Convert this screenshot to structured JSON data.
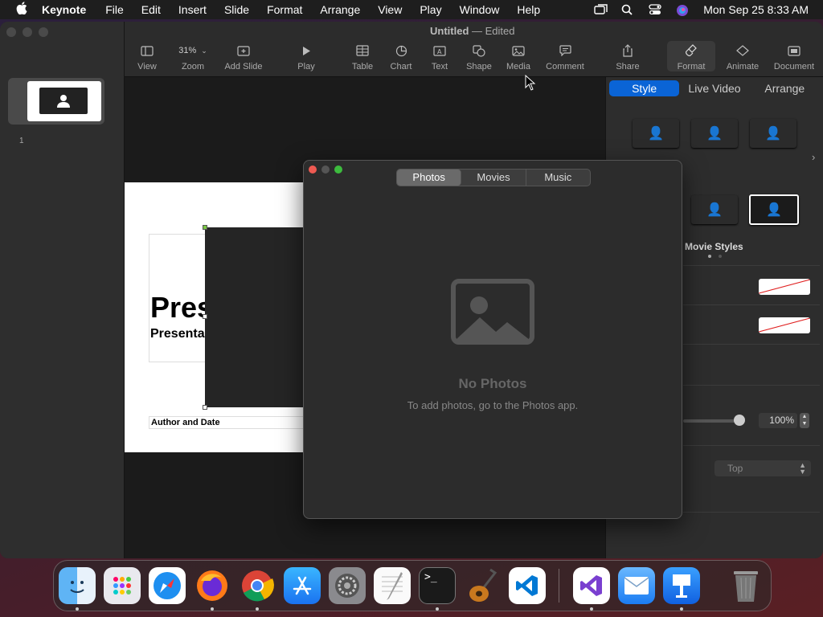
{
  "menubar": {
    "app_name": "Keynote",
    "items": [
      "File",
      "Edit",
      "Insert",
      "Slide",
      "Format",
      "Arrange",
      "View",
      "Play",
      "Window",
      "Help"
    ],
    "datetime": "Mon Sep 25  8:33 AM"
  },
  "window": {
    "doc_name": "Untitled",
    "doc_state": "Edited"
  },
  "toolbar": {
    "zoom_value": "31%",
    "items": [
      {
        "label": "View",
        "icon": "sidebar-icon"
      },
      {
        "label": "Zoom",
        "icon": "zoom-icon"
      },
      {
        "label": "Add Slide",
        "icon": "add-slide-icon"
      },
      {
        "label": "Play",
        "icon": "play-icon"
      },
      {
        "label": "Table",
        "icon": "table-icon"
      },
      {
        "label": "Chart",
        "icon": "chart-icon"
      },
      {
        "label": "Text",
        "icon": "text-icon"
      },
      {
        "label": "Shape",
        "icon": "shape-icon"
      },
      {
        "label": "Media",
        "icon": "media-icon"
      },
      {
        "label": "Comment",
        "icon": "comment-icon"
      },
      {
        "label": "Share",
        "icon": "share-icon"
      },
      {
        "label": "Format",
        "icon": "format-brush-icon"
      },
      {
        "label": "Animate",
        "icon": "animate-icon"
      },
      {
        "label": "Document",
        "icon": "document-icon"
      }
    ]
  },
  "navigator": {
    "slide_number": "1"
  },
  "slide": {
    "title": "Pres",
    "subtitle": "Presenta",
    "author": "Author and Date"
  },
  "inspector": {
    "tabs": [
      "Style",
      "Live Video",
      "Arrange"
    ],
    "active_tab": "Style",
    "movie_styles_label": "Movie Styles",
    "opacity_value": "100%",
    "position_select": "Top"
  },
  "media_browser": {
    "tabs": [
      "Photos",
      "Movies",
      "Music"
    ],
    "active_tab": "Photos",
    "empty_title": "No Photos",
    "empty_subtitle": "To add photos, go to the Photos app."
  },
  "dock": {
    "apps": [
      "Finder",
      "Launchpad",
      "Safari",
      "Firefox",
      "Chrome",
      "App Store",
      "System Settings",
      "TextEdit",
      "Terminal",
      "GarageBand",
      "Visual Studio Code",
      "Visual Studio",
      "Mail",
      "Keynote",
      "Trash"
    ]
  }
}
